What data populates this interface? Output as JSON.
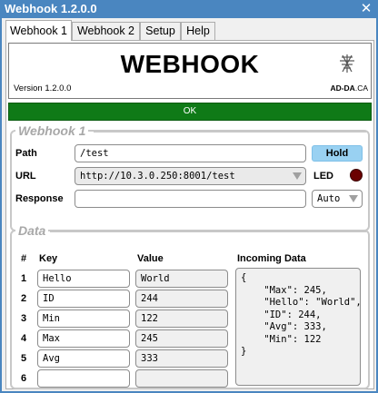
{
  "window": {
    "title": "Webhook 1.2.0.0",
    "close_glyph": "✕"
  },
  "tabs": [
    {
      "label": "Webhook 1",
      "active": true
    },
    {
      "label": "Webhook 2",
      "active": false
    },
    {
      "label": "Setup",
      "active": false
    },
    {
      "label": "Help",
      "active": false
    }
  ],
  "header": {
    "title": "WEBHOOK",
    "version": "Version 1.2.0.0",
    "logo_text_bold": "AD-DA",
    "logo_text_rest": ".CA"
  },
  "ok_button": {
    "label": "OK",
    "color": "#0f7a17"
  },
  "webhook": {
    "legend": "Webhook 1",
    "path_label": "Path",
    "path_value": "/test",
    "hold_label": "Hold",
    "url_label": "URL",
    "url_value": "http://10.3.0.250:8001/test",
    "led_label": "LED",
    "led_color": "#6b0000",
    "response_label": "Response",
    "response_value": "",
    "response_mode": "Auto"
  },
  "data": {
    "legend": "Data",
    "col_num": "#",
    "col_key": "Key",
    "col_value": "Value",
    "col_incoming": "Incoming Data",
    "rows": [
      {
        "num": "1",
        "key": "Hello",
        "value": "World"
      },
      {
        "num": "2",
        "key": "ID",
        "value": "244"
      },
      {
        "num": "3",
        "key": "Min",
        "value": "122"
      },
      {
        "num": "4",
        "key": "Max",
        "value": "245"
      },
      {
        "num": "5",
        "key": "Avg",
        "value": "333"
      },
      {
        "num": "6",
        "key": "",
        "value": ""
      }
    ],
    "incoming_text": "{\n    \"Max\": 245,\n    \"Hello\": \"World\",\n    \"ID\": 244,\n    \"Avg\": 333,\n    \"Min\": 122\n}"
  }
}
